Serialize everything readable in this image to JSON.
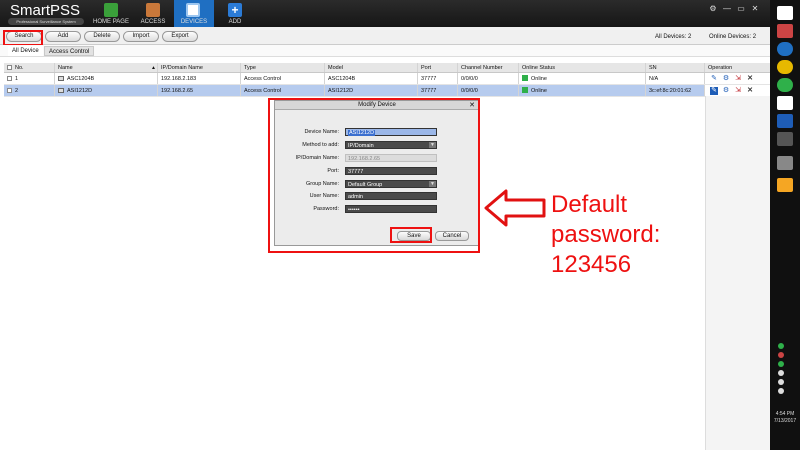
{
  "app": {
    "logo_text": "SmartPSS",
    "logo_subtitle": "Professional Surveillance System"
  },
  "topnav": [
    {
      "label": "HOME PAGE",
      "icon": "home-icon"
    },
    {
      "label": "ACCESS",
      "icon": "door-icon"
    },
    {
      "label": "DEVICES",
      "icon": "devices-icon",
      "active": true
    },
    {
      "label": "ADD",
      "icon": "plus-icon"
    }
  ],
  "window_controls": [
    "⚙",
    "—",
    "▭",
    "✕"
  ],
  "toolbar": {
    "search": "Search",
    "add": "Add",
    "delete": "Delete",
    "import": "Import",
    "export": "Export",
    "all_devices_label": "All Devices:",
    "all_devices_count": "2",
    "online_devices_label": "Online Devices:",
    "online_devices_count": "2"
  },
  "subtabs": [
    "All Device",
    "Access Control"
  ],
  "table": {
    "headers": [
      "No.",
      "Name",
      "IP/Domain Name",
      "Type",
      "Model",
      "Port",
      "Channel Number",
      "Online Status",
      "SN",
      "Operation"
    ],
    "rows": [
      {
        "no": "1",
        "name": "ASC1204B",
        "ip": "192.168.2.183",
        "type": "Access Control",
        "model": "ASC1204B",
        "port": "37777",
        "channel": "0/0/0/0",
        "status": "Online",
        "sn": "N/A"
      },
      {
        "no": "2",
        "name": "ASI1212D",
        "ip": "192.168.2.65",
        "type": "Access Control",
        "model": "ASI1212D",
        "port": "37777",
        "channel": "0/0/0/0",
        "status": "Online",
        "sn": "3c:ef:8c:20:01:62"
      }
    ]
  },
  "modal": {
    "title": "Modify Device",
    "close": "✕",
    "fields": {
      "device_name_label": "Device Name:",
      "device_name_value": "ASI1212D",
      "method_label": "Method to add:",
      "method_value": "IP/Domain",
      "ip_label": "IP/Domain Name:",
      "ip_value": "192.168.2.65",
      "port_label": "Port:",
      "port_value": "37777",
      "group_label": "Group Name:",
      "group_value": "Default Group",
      "user_label": "User Name:",
      "user_value": "admin",
      "password_label": "Password:",
      "password_value": "••••••"
    },
    "save": "Save",
    "cancel": "Cancel"
  },
  "annotation": {
    "line1": "Default",
    "line2": "password:",
    "line3": "123456",
    "color": "#e11111"
  },
  "taskbar": {
    "time": "4:54 PM",
    "date": "7/13/2017"
  }
}
